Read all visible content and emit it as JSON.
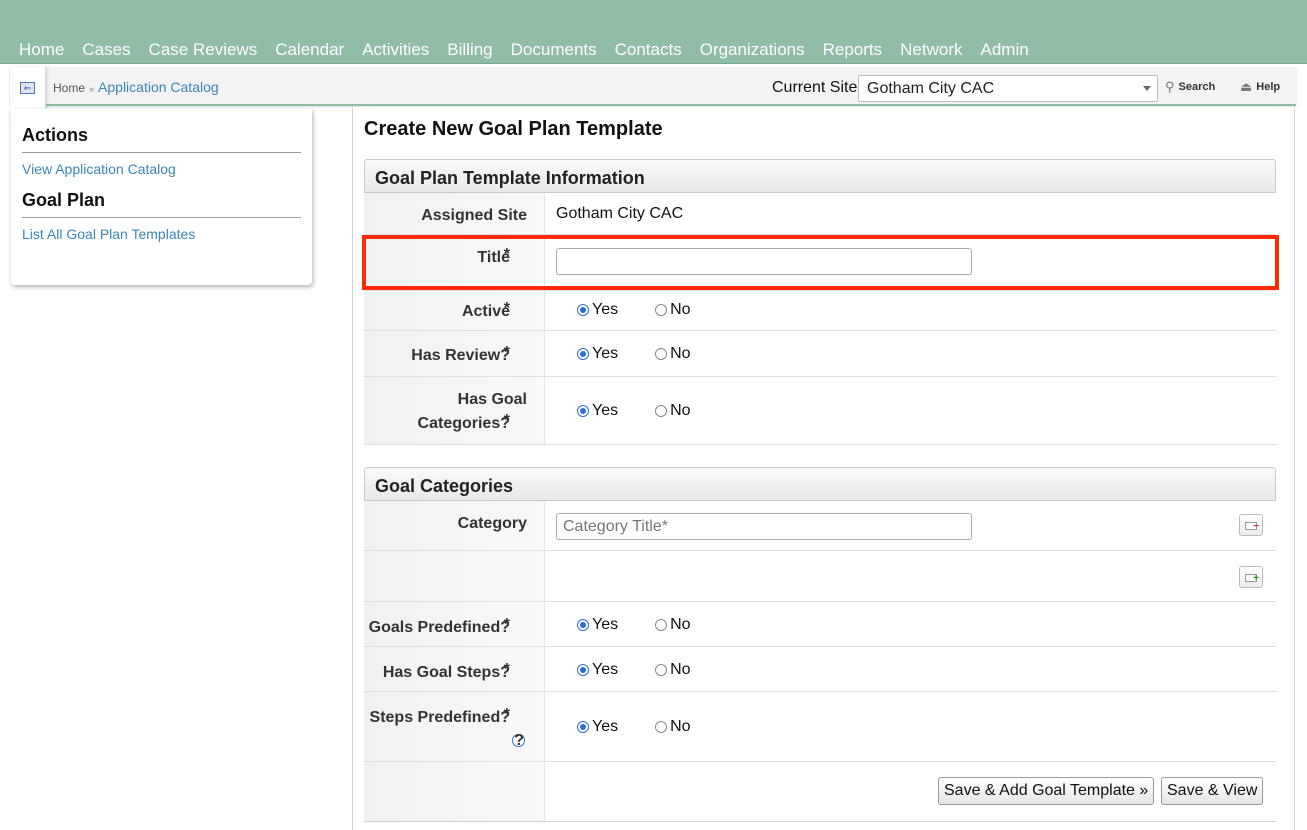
{
  "nav": {
    "items": [
      "Home",
      "Cases",
      "Case Reviews",
      "Calendar",
      "Activities",
      "Billing",
      "Documents",
      "Contacts",
      "Organizations",
      "Reports",
      "Network",
      "Admin"
    ]
  },
  "breadcrumb": {
    "home": "Home",
    "separator": "»",
    "current": "Application Catalog"
  },
  "site": {
    "label": "Current Site",
    "selected": "Gotham City CAC"
  },
  "tools": {
    "search": "Search",
    "help": "Help"
  },
  "sidebar": {
    "actions_heading": "Actions",
    "actions_link": "View Application Catalog",
    "goal_heading": "Goal Plan",
    "goal_link": "List All Goal Plan Templates"
  },
  "page": {
    "title": "Create New Goal Plan Template"
  },
  "info_section": {
    "header": "Goal Plan Template Information",
    "assigned_site_label": "Assigned Site",
    "assigned_site_value": "Gotham City CAC",
    "title_label": "Title",
    "title_value": "",
    "active_label": "Active",
    "has_review_label": "Has Review?",
    "has_goal_categories_label_1": "Has Goal",
    "has_goal_categories_label_2": "Categories?"
  },
  "categories_section": {
    "header": "Goal Categories",
    "category_label": "Category",
    "category_placeholder": "Category Title*",
    "goals_predefined_label": "Goals Predefined?",
    "has_goal_steps_label": "Has Goal Steps?",
    "steps_predefined_label": "Steps Predefined?"
  },
  "radio": {
    "yes": "Yes",
    "no": "No"
  },
  "required_mark": "*",
  "help_glyph": "?",
  "buttons": {
    "save_add": "Save & Add Goal Template »",
    "save_view": "Save & View"
  }
}
